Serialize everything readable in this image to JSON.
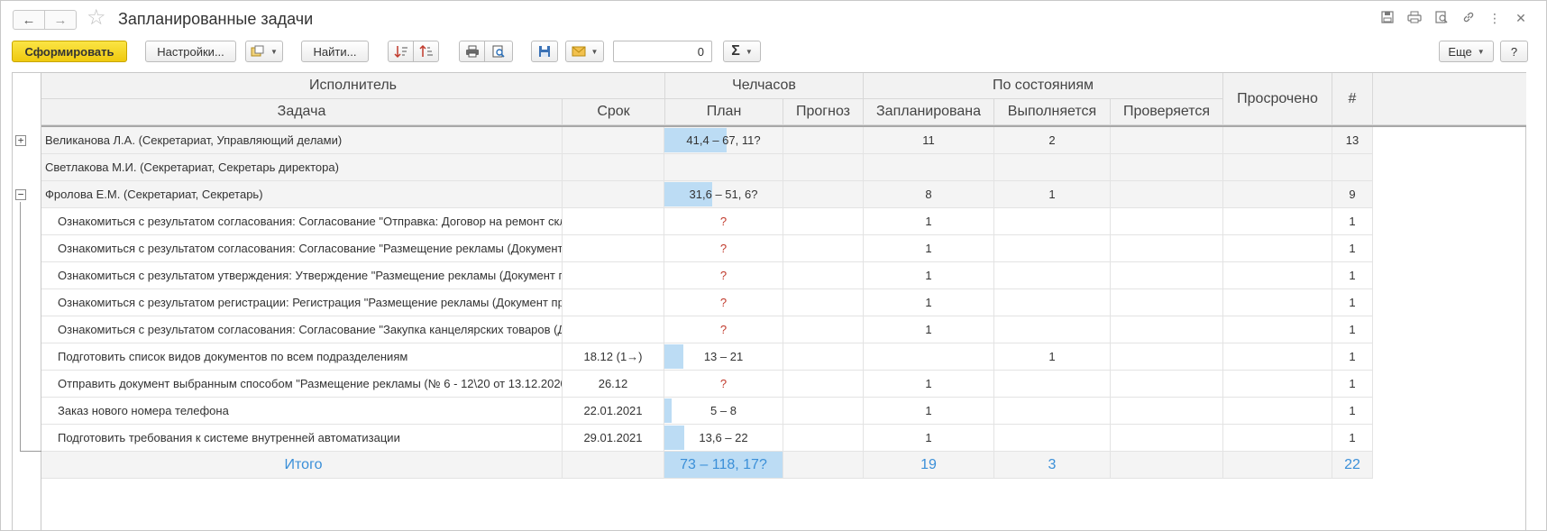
{
  "window": {
    "title": "Запланированные задачи",
    "back_label": "←",
    "forward_label": "→"
  },
  "toolbar": {
    "generate_label": "Сформировать",
    "settings_label": "Настройки...",
    "find_label": "Найти...",
    "counter_value": "0",
    "sum_label": "Σ",
    "more_label": "Еще",
    "help_label": "?"
  },
  "table": {
    "headers": {
      "executor": "Исполнитель",
      "task": "Задача",
      "deadline": "Срок",
      "man_hours": "Челчасов",
      "plan": "План",
      "forecast": "Прогноз",
      "by_state": "По состояниям",
      "planned": "Запланирована",
      "in_progress": "Выполняется",
      "checking": "Проверяется",
      "overdue": "Просрочено",
      "count": "#"
    },
    "rows": [
      {
        "type": "group",
        "expander": "+",
        "name": "Великанова Л.А. (Секретариат, Управляющий делами)",
        "srok": "",
        "plan": "41,4 – 67, 11?",
        "plan_fill": 0.52,
        "prognoz": "",
        "zap": "11",
        "vyp": "2",
        "prov": "",
        "pros": "",
        "num": "13"
      },
      {
        "type": "group",
        "expander": "",
        "name": "Светлакова М.И. (Секретариат, Секретарь директора)",
        "srok": "",
        "plan": "",
        "plan_fill": 0,
        "prognoz": "",
        "zap": "",
        "vyp": "",
        "prov": "",
        "pros": "",
        "num": ""
      },
      {
        "type": "group",
        "expander": "−",
        "name": "Фролова Е.М. (Секретариат, Секретарь)",
        "srok": "",
        "plan": "31,6 – 51, 6?",
        "plan_fill": 0.4,
        "prognoz": "",
        "zap": "8",
        "vyp": "1",
        "prov": "",
        "pros": "",
        "num": "9"
      },
      {
        "type": "task",
        "name": "Ознакомиться с результатом согласования: Согласование \"Отправка: Договор на ремонт скл",
        "srok": "",
        "plan": "?",
        "plan_fill": 0,
        "prognoz": "",
        "zap": "1",
        "vyp": "",
        "prov": "",
        "pros": "",
        "num": "1"
      },
      {
        "type": "task",
        "name": "Ознакомиться с результатом согласования: Согласование \"Размещение рекламы (Документ",
        "srok": "",
        "plan": "?",
        "plan_fill": 0,
        "prognoz": "",
        "zap": "1",
        "vyp": "",
        "prov": "",
        "pros": "",
        "num": "1"
      },
      {
        "type": "task",
        "name": "Ознакомиться с результатом утверждения: Утверждение \"Размещение рекламы (Документ п",
        "srok": "",
        "plan": "?",
        "plan_fill": 0,
        "prognoz": "",
        "zap": "1",
        "vyp": "",
        "prov": "",
        "pros": "",
        "num": "1"
      },
      {
        "type": "task",
        "name": "Ознакомиться с результатом регистрации: Регистрация \"Размещение рекламы (Документ про",
        "srok": "",
        "plan": "?",
        "plan_fill": 0,
        "prognoz": "",
        "zap": "1",
        "vyp": "",
        "prov": "",
        "pros": "",
        "num": "1"
      },
      {
        "type": "task",
        "name": "Ознакомиться с результатом согласования: Согласование \"Закупка канцелярских товаров (Д",
        "srok": "",
        "plan": "?",
        "plan_fill": 0,
        "prognoz": "",
        "zap": "1",
        "vyp": "",
        "prov": "",
        "pros": "",
        "num": "1"
      },
      {
        "type": "task",
        "name": "Подготовить список видов документов по всем подразделениям",
        "srok": "18.12 (1→)",
        "plan": "13 – 21",
        "plan_fill": 0.16,
        "prognoz": "",
        "zap": "",
        "vyp": "1",
        "prov": "",
        "pros": "",
        "num": "1"
      },
      {
        "type": "task",
        "name": "Отправить документ выбранным способом \"Размещение рекламы (№ 6 - 12\\20 от 13.12.2020",
        "srok": "26.12",
        "plan": "?",
        "plan_fill": 0,
        "prognoz": "",
        "zap": "1",
        "vyp": "",
        "prov": "",
        "pros": "",
        "num": "1"
      },
      {
        "type": "task",
        "name": "Заказ нового номера телефона",
        "srok": "22.01.2021",
        "plan": "5 – 8",
        "plan_fill": 0.06,
        "prognoz": "",
        "zap": "1",
        "vyp": "",
        "prov": "",
        "pros": "",
        "num": "1"
      },
      {
        "type": "task",
        "name": "Подготовить требования к системе внутренней автоматизации",
        "srok": "29.01.2021",
        "plan": "13,6 – 22",
        "plan_fill": 0.17,
        "prognoz": "",
        "zap": "1",
        "vyp": "",
        "prov": "",
        "pros": "",
        "num": "1"
      }
    ],
    "total": {
      "label": "Итого",
      "plan": "73 – 118, 17?",
      "zap": "19",
      "vyp": "3",
      "num": "22"
    }
  },
  "colors": {
    "bar_fill": "#bcdcf4",
    "total_text": "#3a8fd8",
    "question_mark": "#c0392b",
    "primary_button": "#f5d51f"
  },
  "icons": [
    "back-arrow-icon",
    "forward-arrow-icon",
    "favorite-star-icon",
    "save-icon",
    "print-icon",
    "preview-icon",
    "link-icon",
    "more-vertical-icon",
    "close-icon",
    "variant-icon",
    "sort-asc-icon",
    "sort-desc-icon",
    "mail-icon",
    "sum-icon"
  ]
}
